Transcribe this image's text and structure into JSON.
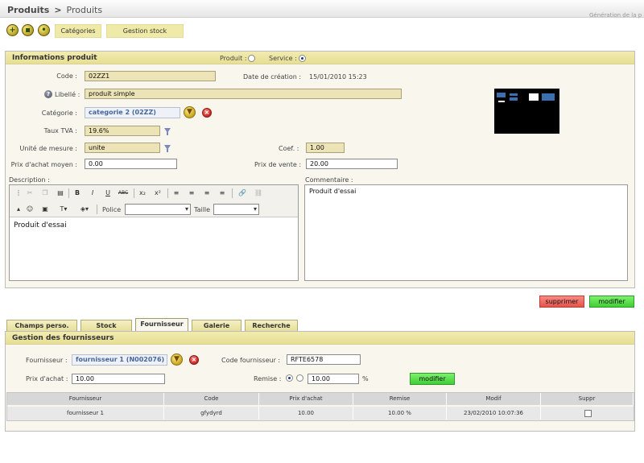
{
  "breadcrumb": {
    "root": "Produits",
    "separator": ">",
    "current": "Produits"
  },
  "corner_text": "Génération de la p",
  "toolbar": {
    "icons": [
      "add-icon",
      "folder-icon",
      "chat-icon"
    ],
    "buttons": [
      "Catégories",
      "Gestion stock"
    ]
  },
  "product": {
    "title": "Informations produit",
    "type_produit_label": "Produit :",
    "type_service_label": "Service :",
    "selected_type": "Service",
    "code_label": "Code :",
    "code_value": "02ZZ1",
    "date_label": "Date de création :",
    "date_value": "15/01/2010 15:23",
    "libelle_label": "Libellé :",
    "libelle_value": "produit simple",
    "categorie_label": "Catégorie :",
    "categorie_value": "categorie 2 (02ZZ)",
    "tva_label": "Taux TVA :",
    "tva_value": "19.6%",
    "unite_label": "Unité de mesure :",
    "unite_value": "unite",
    "coef_label": "Coef. :",
    "coef_value": "1.00",
    "prix_achat_label": "Prix d'achat moyen :",
    "prix_achat_value": "0.00",
    "prix_vente_label": "Prix de vente :",
    "prix_vente_value": "20.00",
    "description_label": "Description :",
    "description_text": "Produit d'essai",
    "commentaire_label": "Commentaire :",
    "commentaire_text": "Produit d'essai",
    "editor": {
      "police_label": "Police",
      "taille_label": "Taille"
    }
  },
  "actions": {
    "supprimer": "supprimer",
    "modifier": "modifier"
  },
  "tabs": [
    {
      "label": "Champs perso.",
      "active": false
    },
    {
      "label": "Stock",
      "active": false
    },
    {
      "label": "Fournisseur",
      "active": true
    },
    {
      "label": "Galerie",
      "active": false
    },
    {
      "label": "Recherche",
      "active": false
    }
  ],
  "suppliers": {
    "title": "Gestion des fournisseurs",
    "fournisseur_label": "Fournisseur :",
    "fournisseur_value": "fournisseur 1  (N002076)",
    "code_label": "Code fournisseur :",
    "code_value": "RFTE6578",
    "prix_label": "Prix d'achat :",
    "prix_value": "10.00",
    "remise_label": "Remise :",
    "remise_value": "10.00",
    "remise_unit": "%",
    "modifier": "modifier",
    "columns": [
      "Fournisseur",
      "Code",
      "Prix d'achat",
      "Remise",
      "Modif",
      "Suppr"
    ],
    "rows": [
      {
        "fournisseur": "fournisseur 1",
        "code": "gfydyrd",
        "prix": "10.00",
        "remise": "10.00 %",
        "modif": "23/02/2010 10:07:36",
        "suppr": false
      }
    ]
  }
}
